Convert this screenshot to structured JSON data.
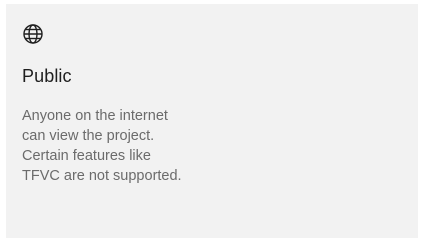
{
  "option": {
    "icon": "globe-icon",
    "title": "Public",
    "description_lines": [
      "Anyone on the internet",
      "can view the project.",
      "Certain features like",
      "TFVC are not supported."
    ]
  },
  "colors": {
    "card_background": "#f2f2f2",
    "title_text": "#1f1f1f",
    "description_text": "#6b6b6b"
  }
}
